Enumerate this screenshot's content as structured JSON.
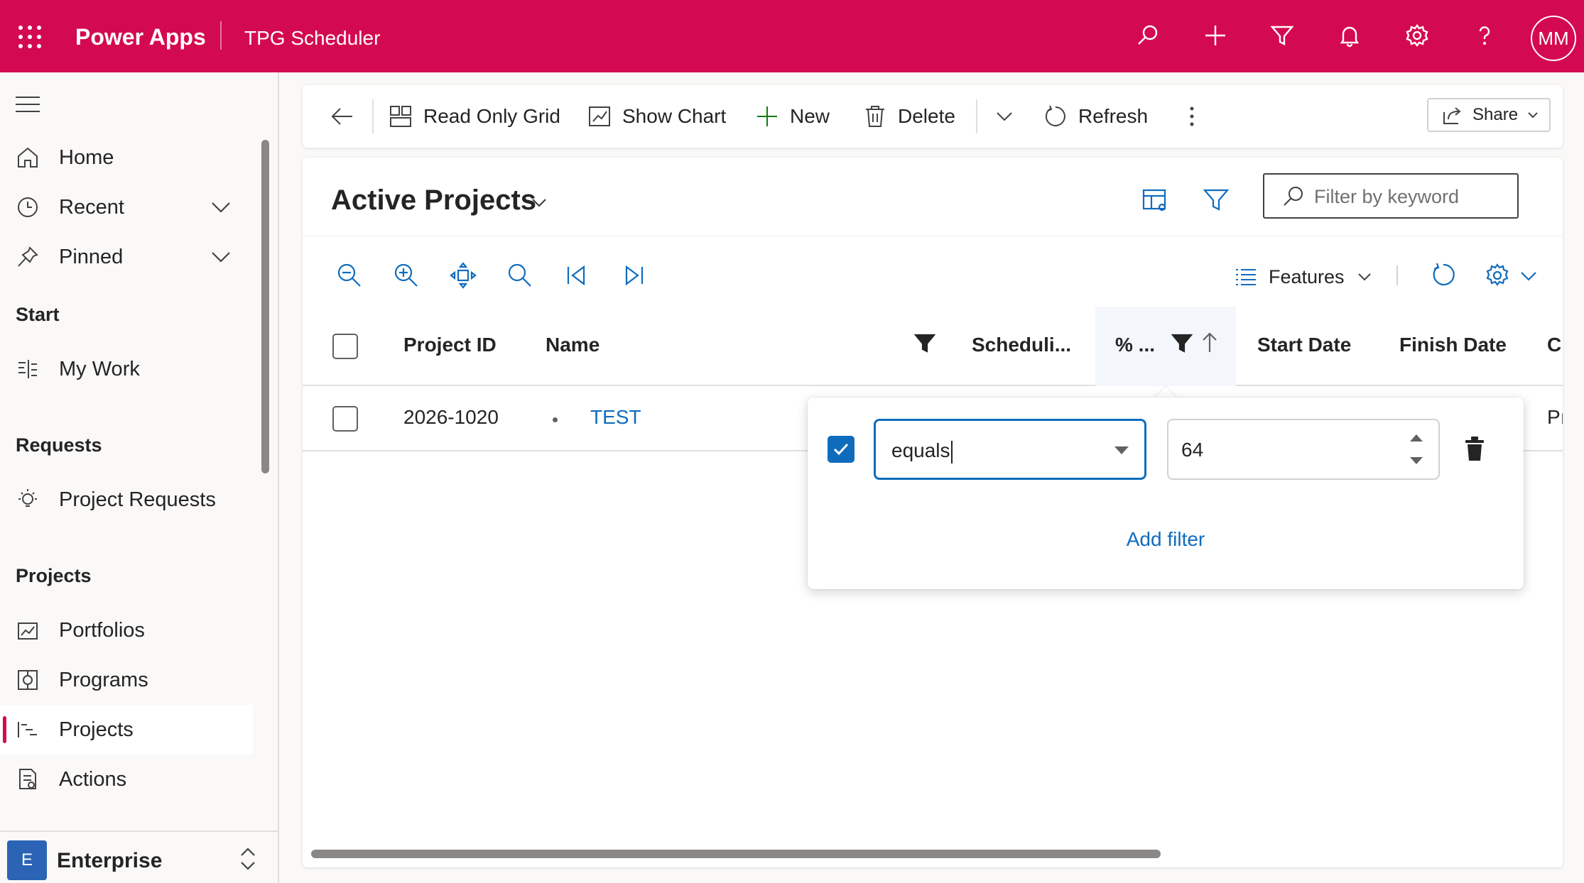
{
  "header": {
    "app_name": "Power Apps",
    "app_title": "TPG Scheduler",
    "avatar_initials": "MM",
    "icons": [
      "search-icon",
      "add-icon",
      "filter-icon",
      "bell-icon",
      "gear-icon",
      "help-icon"
    ],
    "brand_color": "#d40a50"
  },
  "sidebar": {
    "items": [
      {
        "label": "Home",
        "icon": "home-icon"
      },
      {
        "label": "Recent",
        "icon": "clock-icon"
      },
      {
        "label": "Pinned",
        "icon": "pin-icon"
      }
    ],
    "sections": [
      {
        "title": "Start",
        "items": [
          {
            "label": "My Work",
            "icon": "my-work-icon"
          }
        ]
      },
      {
        "title": "Requests",
        "items": [
          {
            "label": "Project Requests",
            "icon": "lightbulb-icon"
          }
        ]
      },
      {
        "title": "Projects",
        "items": [
          {
            "label": "Portfolios",
            "icon": "portfolio-icon"
          },
          {
            "label": "Programs",
            "icon": "program-icon"
          },
          {
            "label": "Projects",
            "icon": "project-icon",
            "selected": true
          },
          {
            "label": "Actions",
            "icon": "actions-icon"
          }
        ]
      }
    ],
    "area": {
      "badge": "E",
      "name": "Enterprise"
    }
  },
  "commandbar": {
    "read_only_grid": "Read Only Grid",
    "show_chart": "Show Chart",
    "new": "New",
    "delete": "Delete",
    "refresh": "Refresh",
    "share": "Share"
  },
  "view": {
    "title": "Active Projects",
    "search_placeholder": "Filter by keyword",
    "features_label": "Features"
  },
  "grid": {
    "columns": [
      "Project ID",
      "Name",
      "Scheduli...",
      "% ...",
      "Start Date",
      "Finish Date",
      "C"
    ],
    "rows": [
      {
        "project_id": "2026-1020",
        "name": "TEST",
        "trailing": "Pı"
      }
    ]
  },
  "filter_popover": {
    "operator": "equals",
    "value": "64",
    "enabled": true,
    "add_filter": "Add filter"
  },
  "colors": {
    "accent": "#0f6cbd",
    "brand": "#d40a50"
  }
}
